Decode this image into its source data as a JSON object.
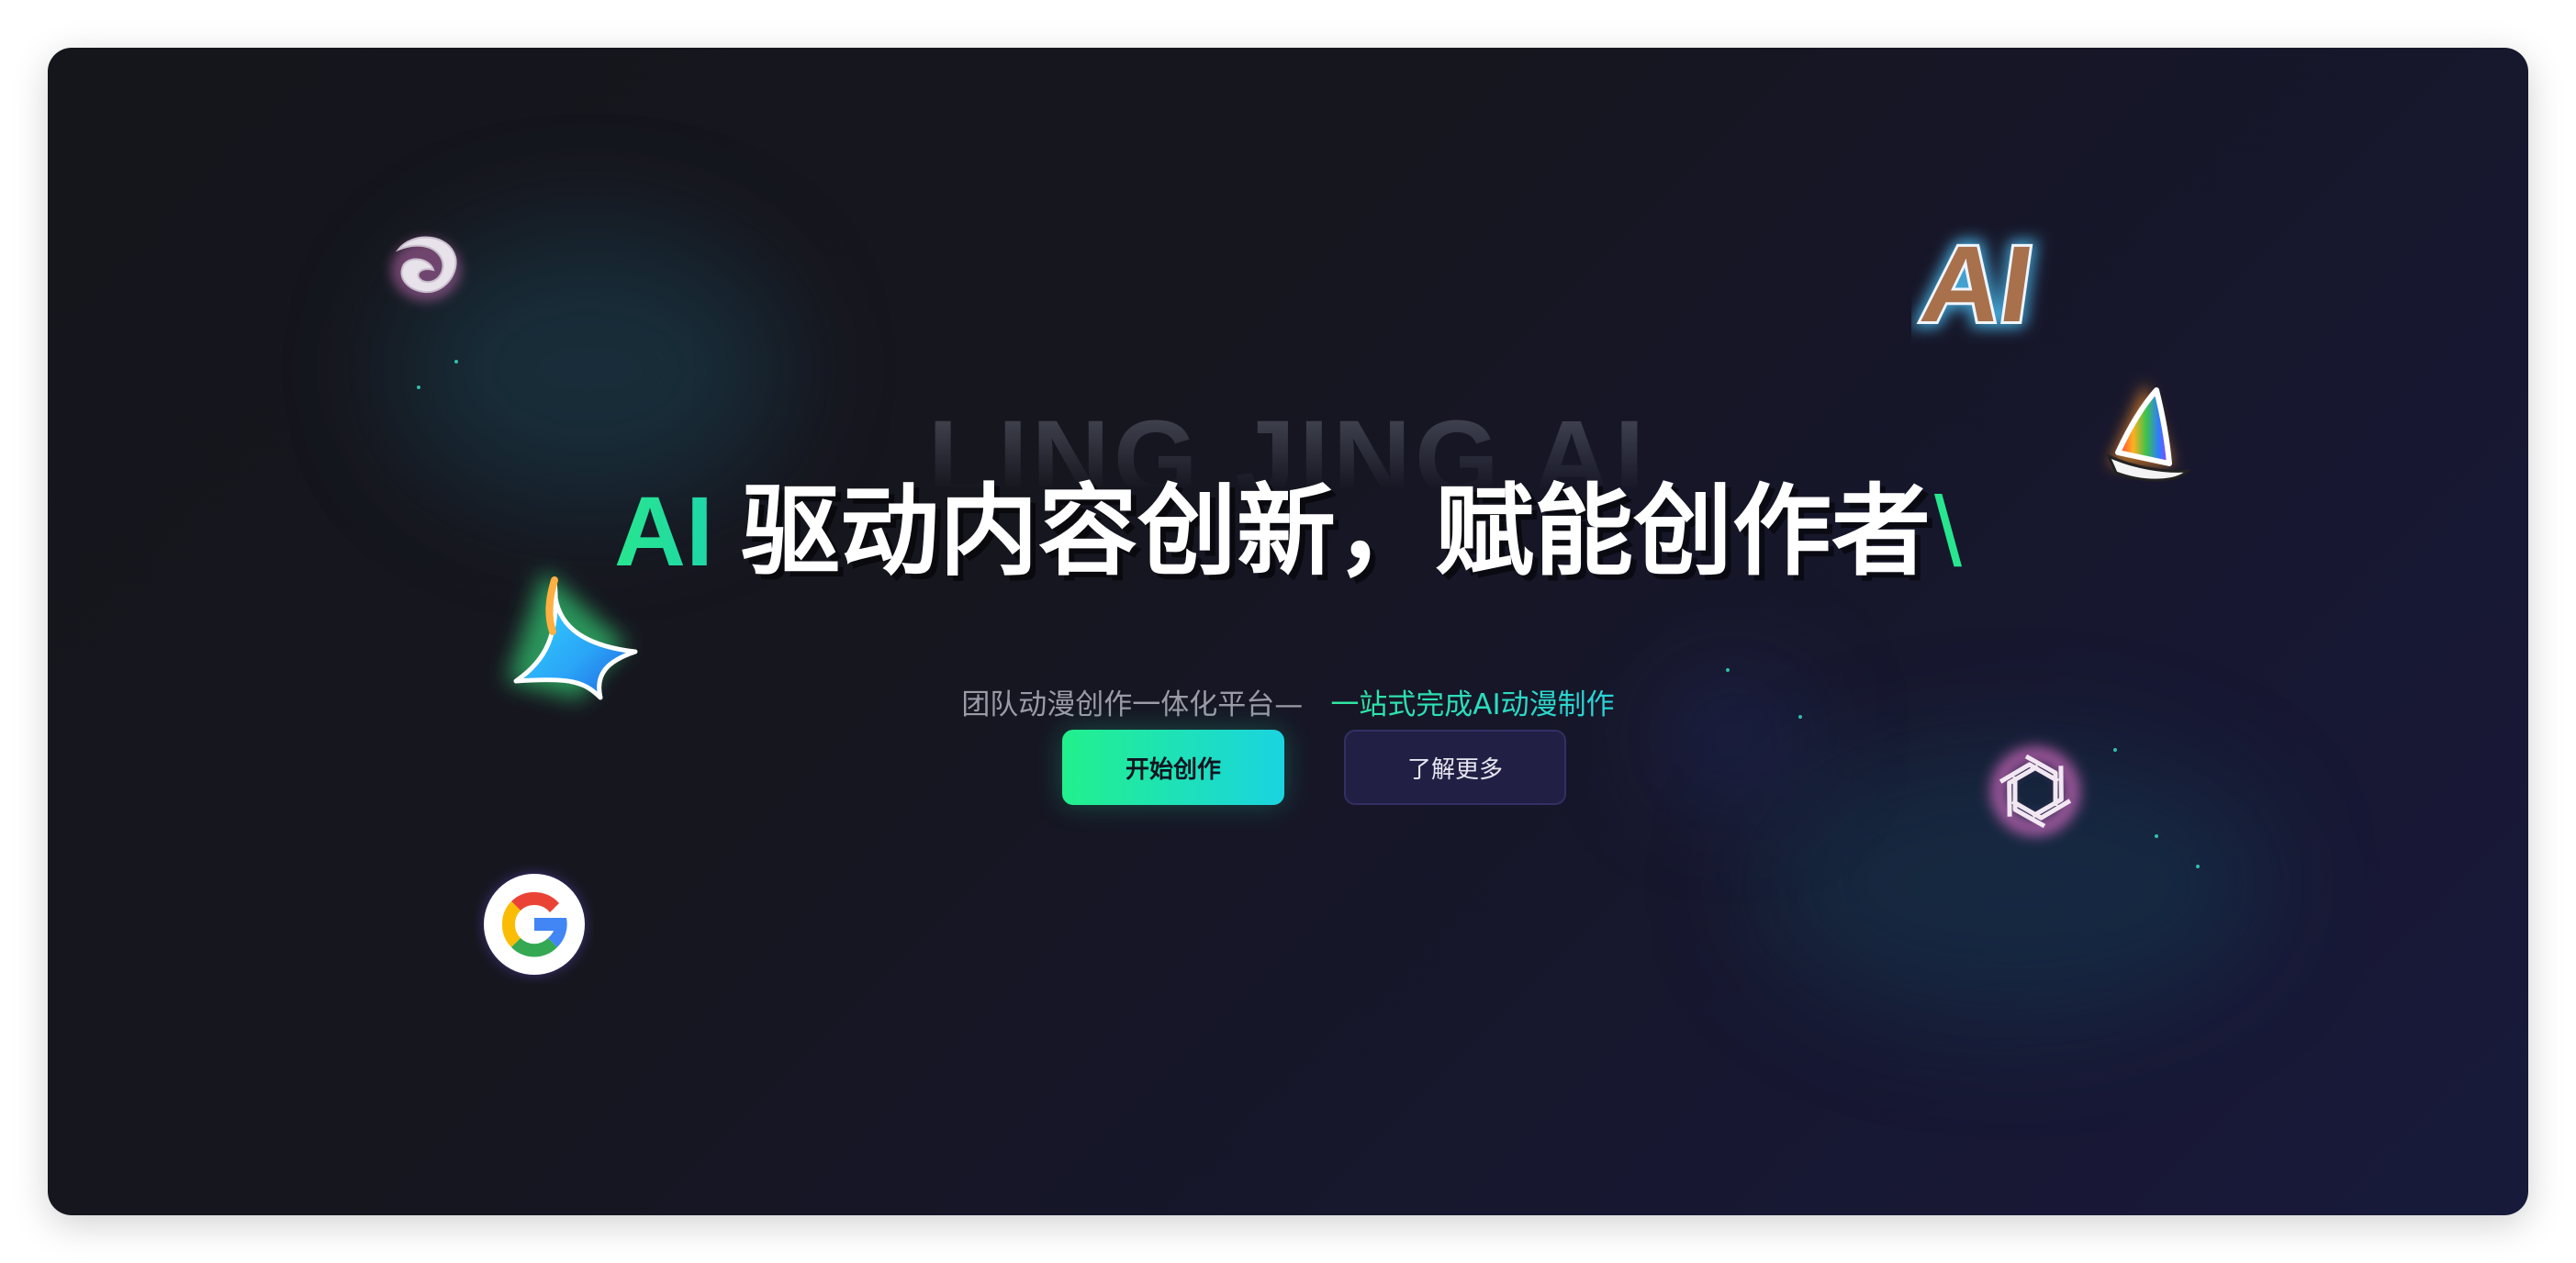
{
  "hero": {
    "ghost_title": "LING JING AI",
    "headline_ai": "AI",
    "headline_main": "驱动内容创新，赋能创作者",
    "headline_cursor": "\\",
    "subtitle_prefix": "团队动漫创作一体化平台—",
    "subtitle_highlight": "一站式完成AI动漫制作"
  },
  "actions": {
    "primary_label": "开始创作",
    "secondary_label": "了解更多"
  },
  "floating_logos": [
    {
      "name": "white-swirl-logo-icon"
    },
    {
      "name": "star-spinner-logo-icon"
    },
    {
      "name": "google-logo-icon"
    },
    {
      "name": "ai-letters-logo-icon"
    },
    {
      "name": "sailboat-logo-icon"
    },
    {
      "name": "openai-logo-icon"
    }
  ],
  "colors": {
    "accent_green": "#27e68f",
    "accent_cyan": "#1ad4e0",
    "background": "#16161f",
    "secondary_button": "#221f45"
  }
}
